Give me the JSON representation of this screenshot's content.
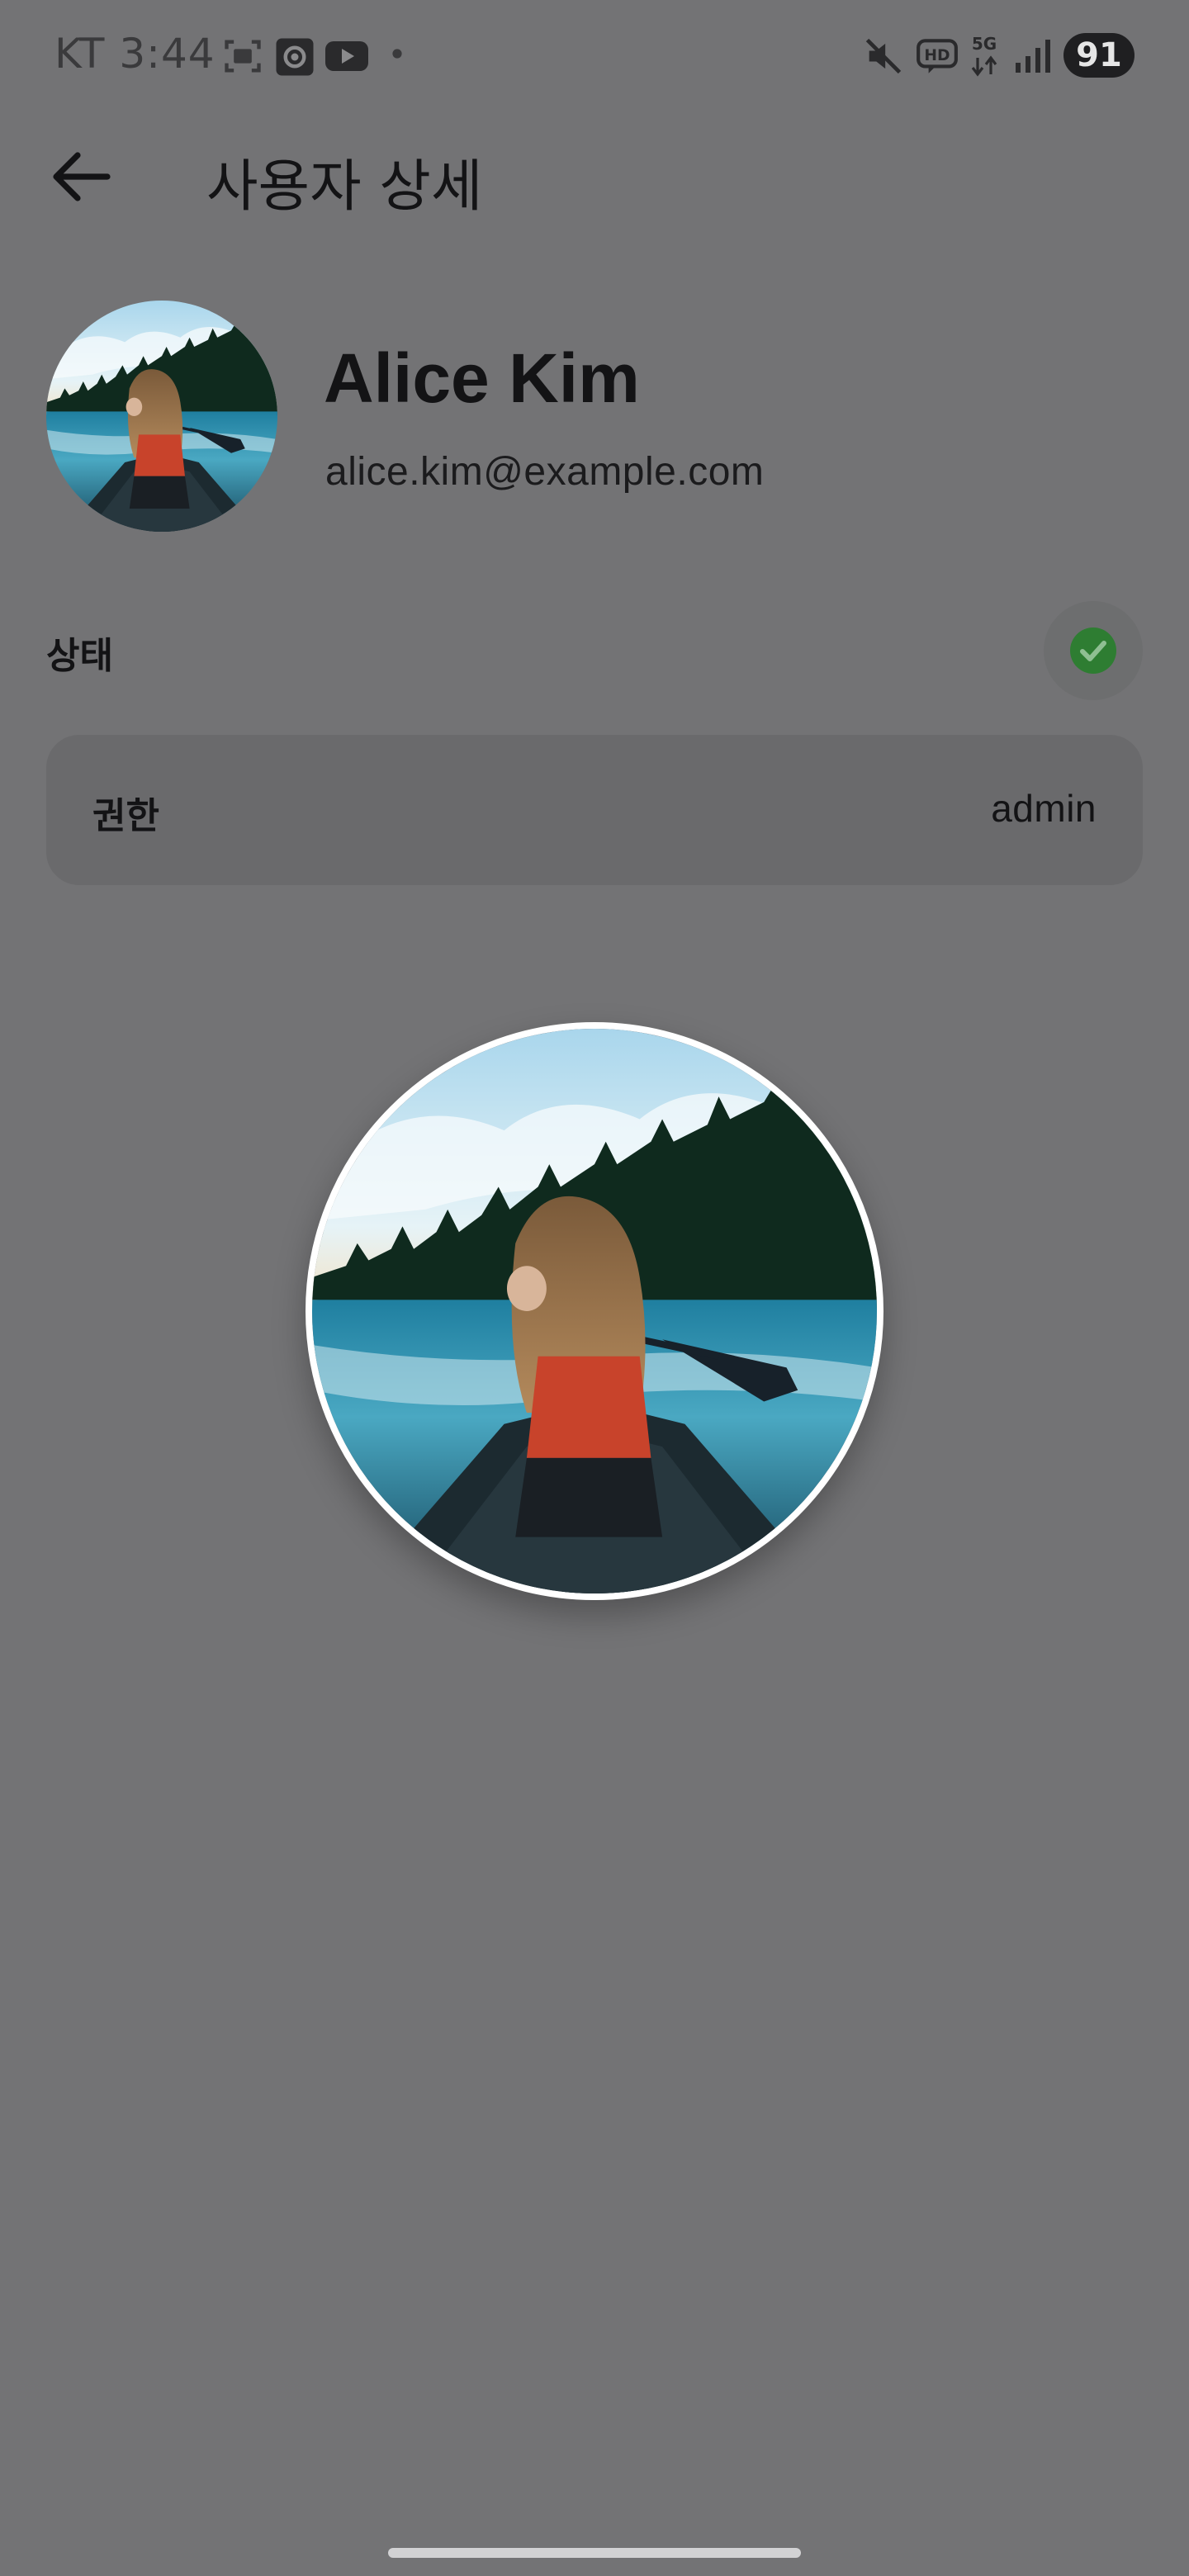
{
  "status_bar": {
    "carrier_time": "KT 3:44",
    "battery_level": "91",
    "icons": [
      "screenshot-icon",
      "screen-record-icon",
      "youtube-icon",
      "notification-dot-icon",
      "mute-icon",
      "hd-voice-icon",
      "5g-icon",
      "signal-icon",
      "battery-icon"
    ]
  },
  "app_bar": {
    "back_icon": "arrow-left-icon",
    "title": "사용자 상세"
  },
  "profile": {
    "name": "Alice Kim",
    "email": "alice.kim@example.com"
  },
  "status_row": {
    "label": "상태",
    "active": true,
    "check_color": "#2e7d32"
  },
  "role_row": {
    "label": "권한",
    "value": "admin"
  },
  "colors": {
    "scrim_background": "#737375",
    "card_background": "#6a6a6c",
    "accent_check": "#2e7d32",
    "photo_border": "#ffffff"
  }
}
